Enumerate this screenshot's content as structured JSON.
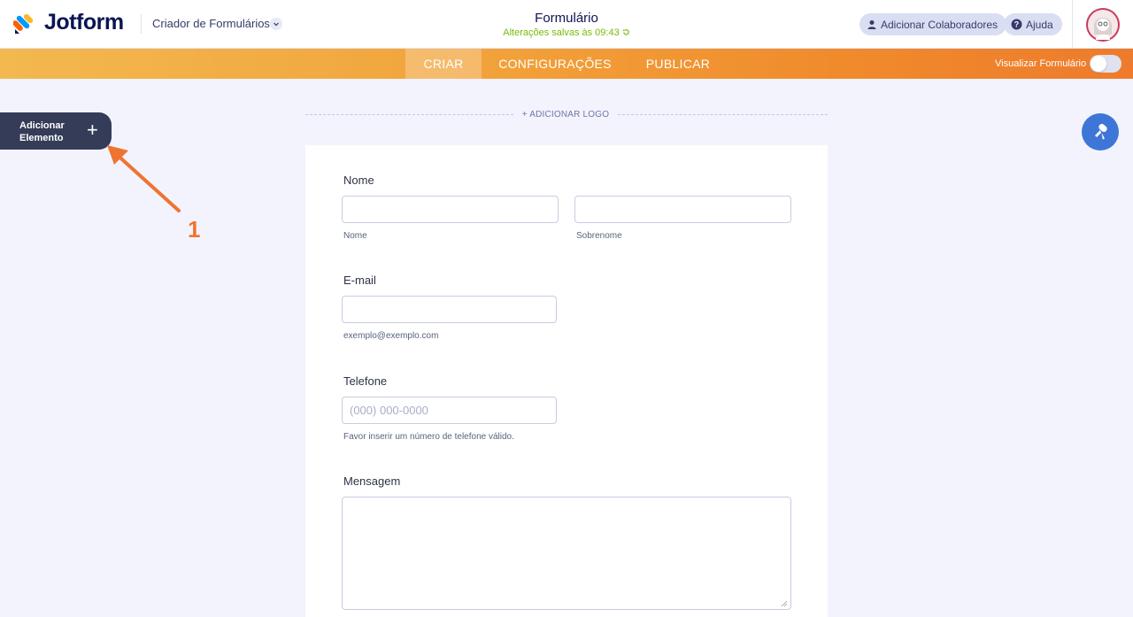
{
  "header": {
    "brand": "Jotform",
    "builder_label": "Criador de Formulários",
    "form_title": "Formulário",
    "save_status": "Alterações salvas às 09:43",
    "collaborators_label": "Adicionar Colaboradores",
    "help_label": "Ajuda"
  },
  "nav": {
    "tabs": [
      {
        "label": "CRIAR",
        "active": true
      },
      {
        "label": "CONFIGURAÇÕES",
        "active": false
      },
      {
        "label": "PUBLICAR",
        "active": false
      }
    ],
    "preview_label": "Visualizar Formulário",
    "preview_enabled": false
  },
  "sidebar": {
    "add_element_line1": "Adicionar",
    "add_element_line2": "Elemento",
    "plus": "+"
  },
  "annotation": {
    "number": "1",
    "color": "#ef7431"
  },
  "form": {
    "add_logo": "+ ADICIONAR LOGO",
    "name": {
      "label": "Nome",
      "first_sublabel": "Nome",
      "last_sublabel": "Sobrenome"
    },
    "email": {
      "label": "E-mail",
      "sublabel": "exemplo@exemplo.com"
    },
    "phone": {
      "label": "Telefone",
      "placeholder": "(000) 000-0000",
      "sublabel": "Favor inserir um número de telefone válido."
    },
    "message": {
      "label": "Mensagem"
    }
  },
  "colors": {
    "accent_orange": "#f08a2c",
    "save_green": "#78bb07",
    "paint_blue": "#3e76d8",
    "dark_panel": "#343c57"
  }
}
